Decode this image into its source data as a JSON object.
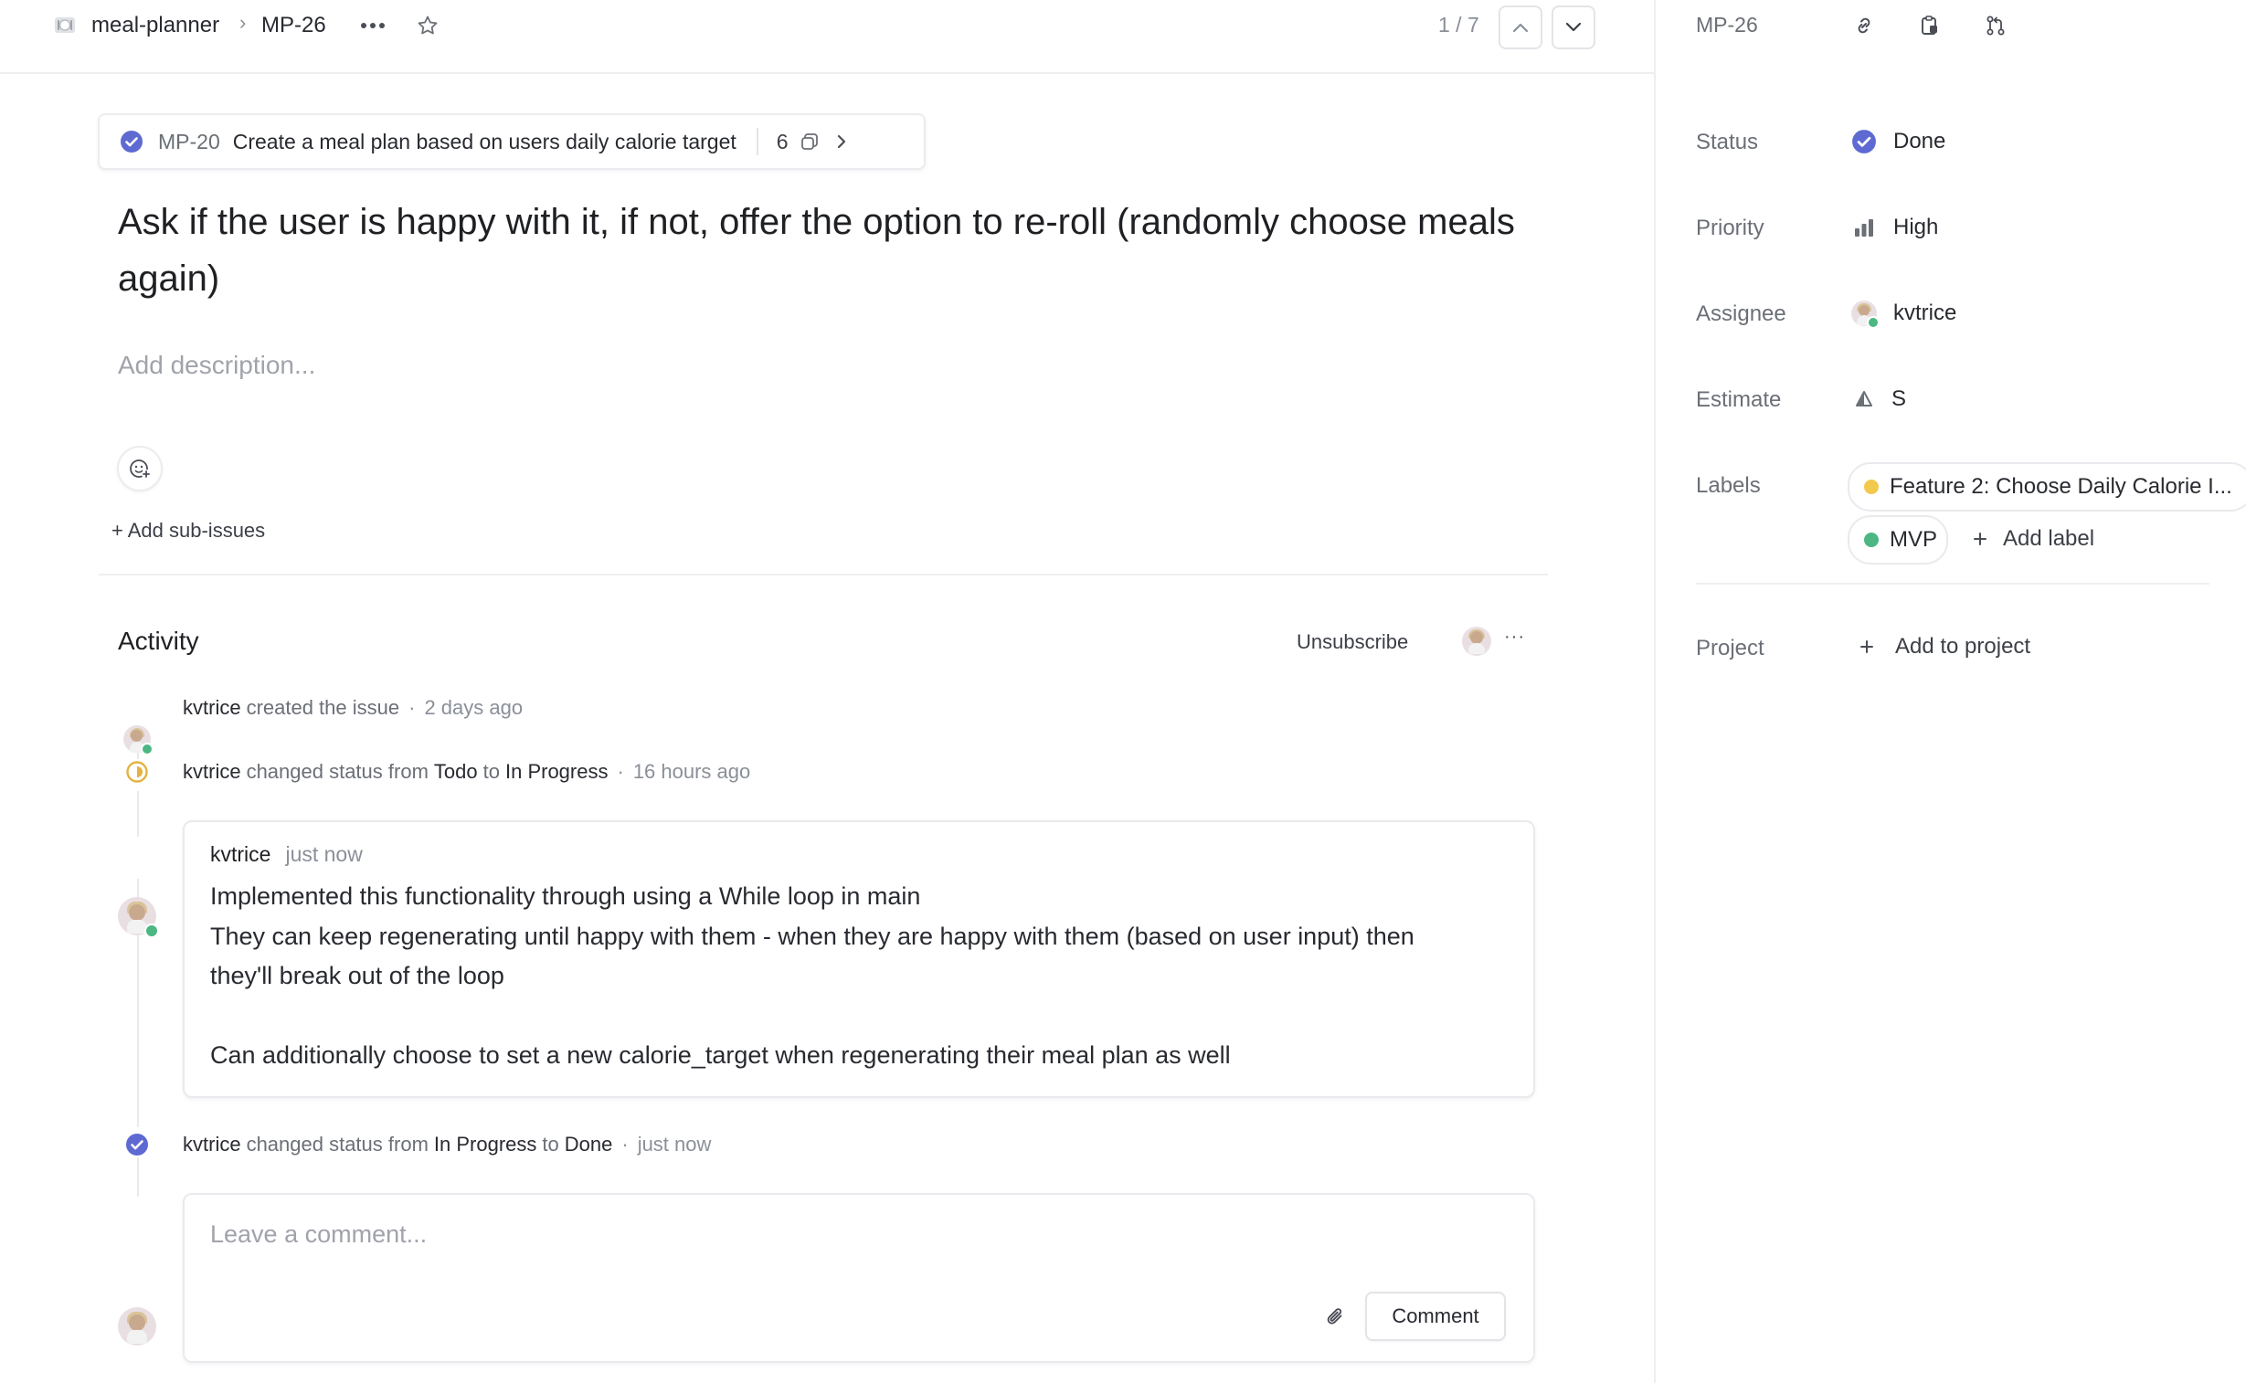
{
  "breadcrumb": {
    "team": "meal-planner",
    "separator": "›",
    "issue_id": "MP-26",
    "team_icon": "plate-icon"
  },
  "pager": {
    "position": "1 / 7"
  },
  "parent_issue": {
    "id": "MP-20",
    "title": "Create a meal plan based on users daily calorie target",
    "sub_count": "6"
  },
  "issue": {
    "title": "Ask if the user is happy with it, if not, offer the option to re-roll (randomly choose meals again)",
    "description_placeholder": "Add description...",
    "add_sub_issues": "+ Add sub-issues"
  },
  "activity": {
    "heading": "Activity",
    "unsubscribe": "Unsubscribe",
    "more": "···",
    "events": [
      {
        "user": "kvtrice",
        "text": "created the issue",
        "dot": "·",
        "time": "2 days ago"
      },
      {
        "user": "kvtrice",
        "text": "changed status from",
        "from": "Todo",
        "to_word": "to",
        "to": "In Progress",
        "dot": "·",
        "time": "16 hours ago"
      },
      {
        "user": "kvtrice",
        "text": "changed status from",
        "from": "In Progress",
        "to_word": "to",
        "to": "Done",
        "dot": "·",
        "time": "just now"
      }
    ],
    "comment": {
      "user": "kvtrice",
      "time": "just now",
      "lines": [
        "Implemented this functionality through using a While loop in main",
        "They can keep regenerating until happy with them - when they are happy with them (based on user input) then",
        "they'll break out of the loop",
        "Can additionally choose to set a new calorie_target when regenerating their meal plan as well"
      ]
    },
    "compose": {
      "placeholder": "Leave a comment...",
      "submit": "Comment"
    }
  },
  "sidebar": {
    "issue_id": "MP-26",
    "status": {
      "label": "Status",
      "value": "Done"
    },
    "priority": {
      "label": "Priority",
      "value": "High"
    },
    "assignee": {
      "label": "Assignee",
      "value": "kvtrice"
    },
    "estimate": {
      "label": "Estimate",
      "value": "S"
    },
    "labels": {
      "label": "Labels",
      "items": [
        {
          "name": "Feature 2: Choose Daily Calorie I...",
          "color": "#f2c94c"
        },
        {
          "name": "MVP",
          "color": "#4cb782"
        }
      ],
      "add": "Add label"
    },
    "project": {
      "label": "Project",
      "add": "Add to project"
    }
  },
  "colors": {
    "accent": "#5e6ad2",
    "in_progress": "#f2c94c",
    "online": "#4cb782"
  }
}
